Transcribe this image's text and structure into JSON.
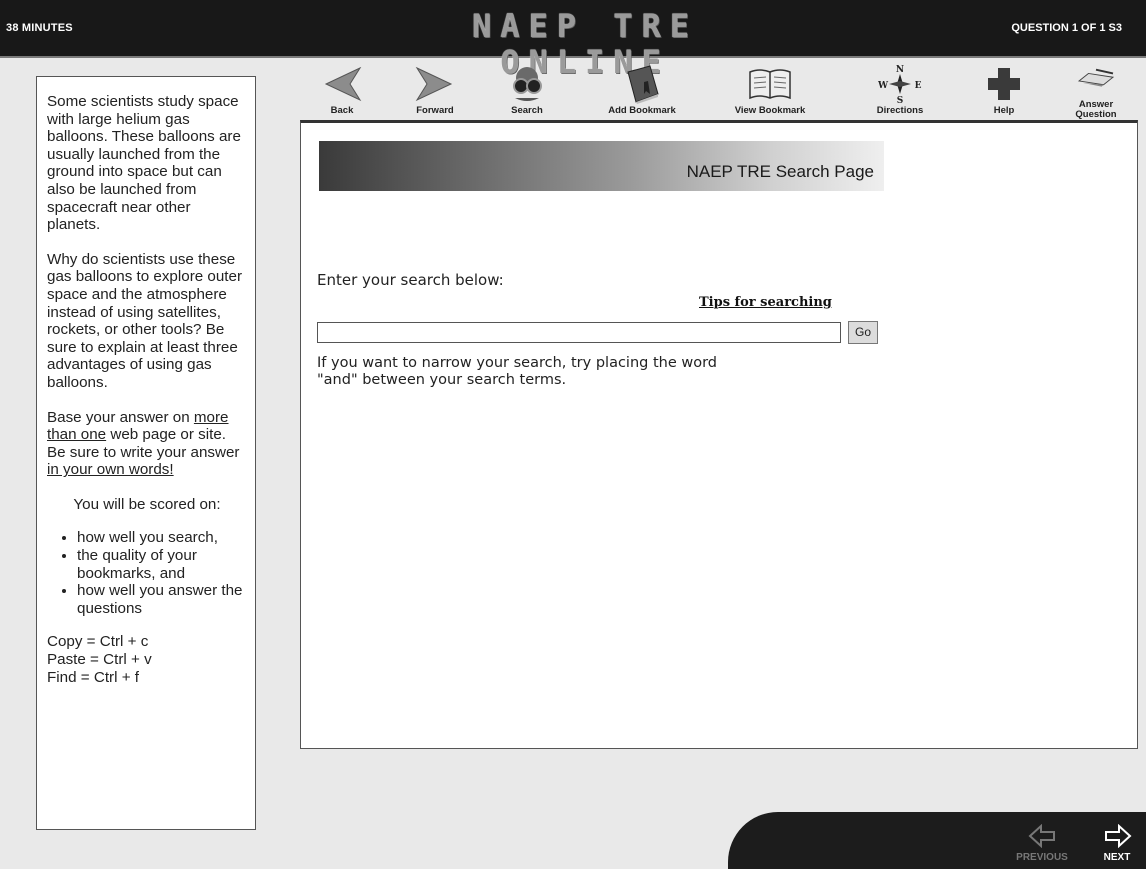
{
  "header": {
    "timer": "38 MINUTES",
    "app_title": "NAEP TRE ONLINE",
    "question_count": "QUESTION 1 OF 1 S3"
  },
  "prompt": {
    "para1": "Some scientists study space with large helium gas balloons. These balloons are usually launched from the ground into space but can also be launched from spacecraft near other planets.",
    "para2": "Why do scientists use these gas balloons to explore outer space and the atmosphere instead of using satellites, rockets, or other tools? Be sure to explain at least three advantages of using gas balloons.",
    "para3_pre": "Base your answer on ",
    "para3_u1": "more than one",
    "para3_mid": " web page or site. Be sure to write your answer ",
    "para3_u2": "in your own words!",
    "scored_heading": "You will be scored on:",
    "criteria": [
      "how well you search,",
      "the quality of your bookmarks, and",
      "how well you answer the questions"
    ],
    "shortcuts": [
      "Copy = Ctrl + c",
      "Paste = Ctrl + v",
      "Find = Ctrl + f"
    ]
  },
  "toolbar": {
    "back": "Back",
    "forward": "Forward",
    "search": "Search",
    "add_bookmark": "Add Bookmark",
    "view_bookmark": "View Bookmark",
    "directions": "Directions",
    "help": "Help",
    "answer_line1": "Answer",
    "answer_line2": "Question"
  },
  "content": {
    "banner_title": "NAEP TRE Search Page",
    "search_prompt": "Enter your search below:",
    "tips_link": "Tips for searching",
    "search_value": "",
    "go_label": "Go",
    "hint_line1": "If you want to narrow your search, try placing the word",
    "hint_line2": "\"and\" between your search terms."
  },
  "footer": {
    "previous": "PREVIOUS",
    "next": "NEXT"
  },
  "colors": {
    "topbar": "#181818",
    "page_bg": "#e9e9e9",
    "panel": "#ffffff"
  },
  "icons": [
    "back-arrow-icon",
    "forward-arrow-icon",
    "search-binoculars-icon",
    "add-bookmark-icon",
    "view-bookmark-icon",
    "compass-directions-icon",
    "help-cross-icon",
    "answer-pencil-icon",
    "previous-arrow-icon",
    "next-arrow-icon"
  ]
}
